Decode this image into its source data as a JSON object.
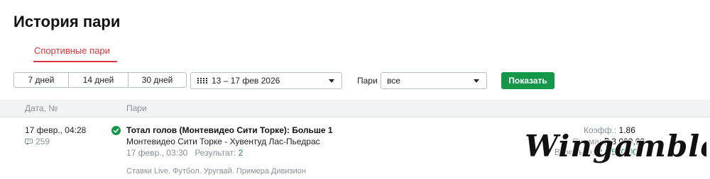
{
  "page": {
    "title": "История пари"
  },
  "tabs": [
    {
      "label": "Спортивные пари",
      "active": true
    }
  ],
  "filters": {
    "periods": [
      "7 дней",
      "14 дней",
      "30 дней"
    ],
    "date_range": "13 – 17 фев 2026",
    "bets_label": "Пари",
    "bets_value": "все",
    "show_label": "Показать"
  },
  "table": {
    "headers": {
      "date": "Дата, №",
      "bets": "Пари"
    },
    "rows": [
      {
        "datetime": "17 февр., 04:28",
        "id": "259",
        "status": "won",
        "title": "Тотал голов (Монтевидео Сити Торке): Больше 1",
        "match": "Монтевидео Сити Торке - Хувентуд Лас-Пьедрас",
        "event_time": "17 февр., 03:30",
        "result_label": "Результат:",
        "result_value": "2",
        "league": "Ставки Live. Футбол. Уругвай. Примера Дивизион",
        "coef_label": "Коэфф.:",
        "coef_value": "1.86",
        "stake_label": "Сумма:",
        "stake_value": "₽ 3 000,00",
        "payout_label": "Выигрыш:",
        "payout_value": "₽ 5 580,00"
      }
    ]
  },
  "watermark": "Wingamble",
  "colors": {
    "accent": "#e0333d",
    "green": "#15974a",
    "muted": "#8a9099"
  }
}
